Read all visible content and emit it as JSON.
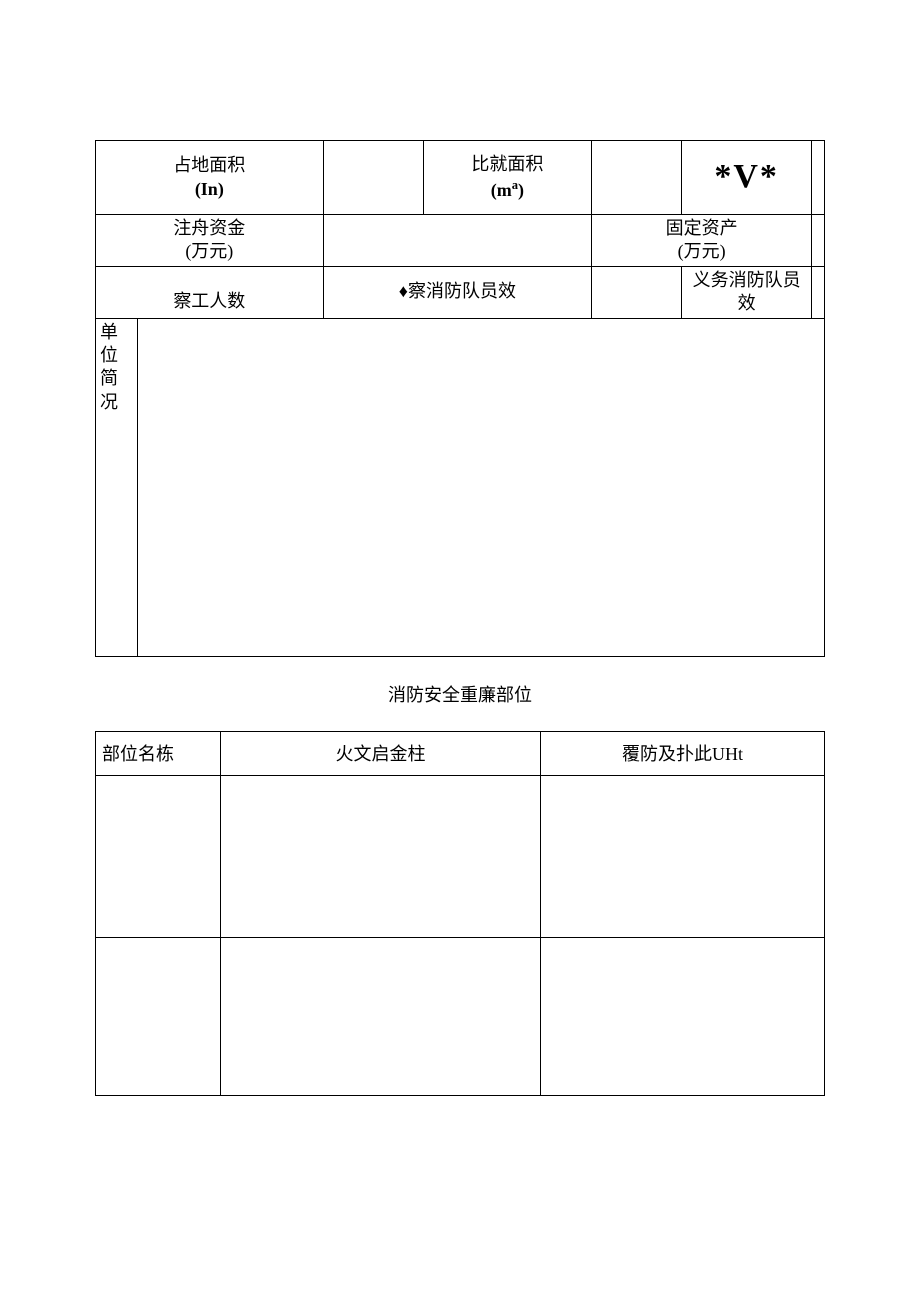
{
  "table1": {
    "r1c1_line1": "占地面积",
    "r1c1_line2": "(In)",
    "r1c2_line1": "比就面积",
    "r1c2_unit": "(m",
    "r1c2_sup": "a",
    "r1c2_close": ")",
    "r1c3": "*V*",
    "r2c1_line1": "注舟资金",
    "r2c1_line2": "(万元)",
    "r2c2_line1": "固定资产",
    "r2c2_line2": "(万元)",
    "r3c1": "察工人数",
    "r3c2": "♦察消防队员效",
    "r3c3": "义务消防队员效",
    "r4_vert": "单位简况"
  },
  "sectionTitle": "消防安全重廉部位",
  "table2": {
    "h1": "部位名栋",
    "h2": "火文启金柱",
    "h3": "覆防及扑此UHt"
  }
}
